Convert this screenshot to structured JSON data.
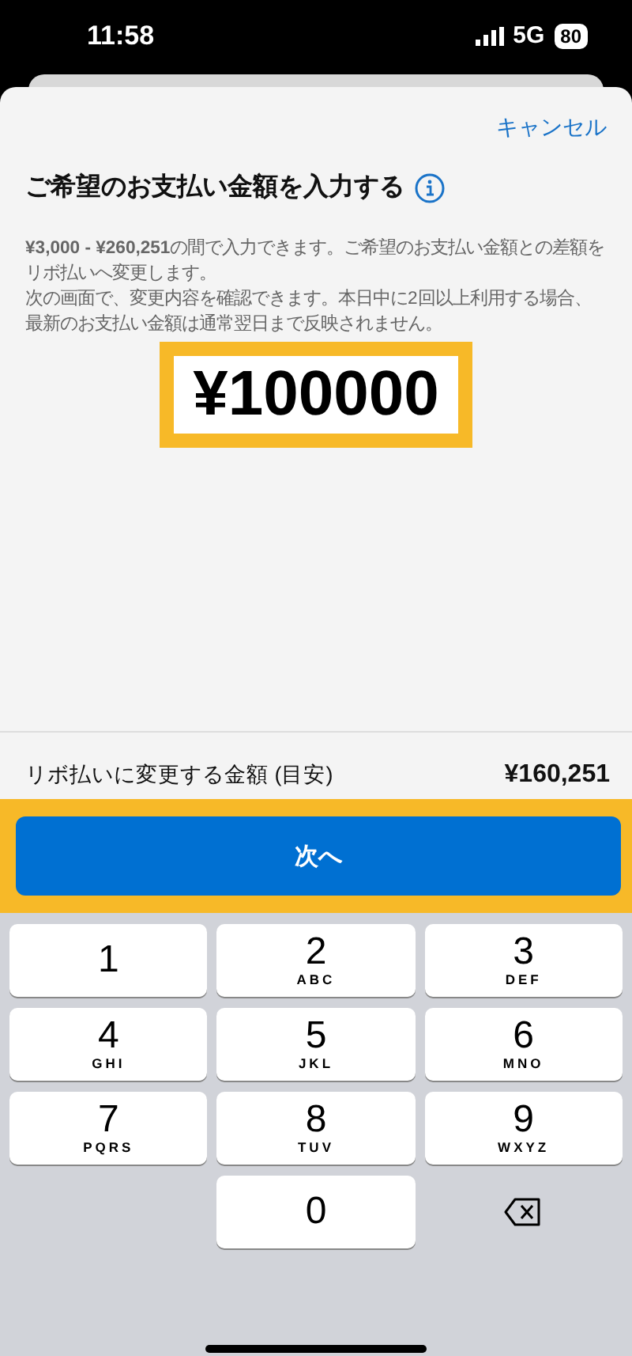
{
  "status_bar": {
    "time": "11:58",
    "network": "5G",
    "battery": "80"
  },
  "sheet": {
    "cancel": "キャンセル",
    "title": "ご希望のお支払い金額を入力する",
    "description": [
      "**¥3,000 - ¥260,251**の間で入力できます。ご希望のお支払い金額との差額をリボ払いへ変更します。",
      "次の画面で、変更内容を確認できます。本日中に2回以上利用する場合、最新のお支払い金額は通常翌日まで反映されません。"
    ],
    "amount": "¥100000"
  },
  "summary": {
    "label": "リボ払いに変更する金額 (目安)",
    "value": "¥160,251"
  },
  "next_button": "次へ",
  "keypad": [
    {
      "kind": "digit",
      "digit": "1"
    },
    {
      "kind": "digit",
      "digit": "2",
      "letters": "ABC"
    },
    {
      "kind": "digit",
      "digit": "3",
      "letters": "DEF"
    },
    {
      "kind": "digit",
      "digit": "4",
      "letters": "GHI"
    },
    {
      "kind": "digit",
      "digit": "5",
      "letters": "JKL"
    },
    {
      "kind": "digit",
      "digit": "6",
      "letters": "MNO"
    },
    {
      "kind": "digit",
      "digit": "7",
      "letters": "PQRS"
    },
    {
      "kind": "digit",
      "digit": "8",
      "letters": "TUV"
    },
    {
      "kind": "digit",
      "digit": "9",
      "letters": "WXYZ"
    },
    {
      "kind": "blank"
    },
    {
      "kind": "digit",
      "digit": "0"
    },
    {
      "kind": "delete"
    }
  ]
}
